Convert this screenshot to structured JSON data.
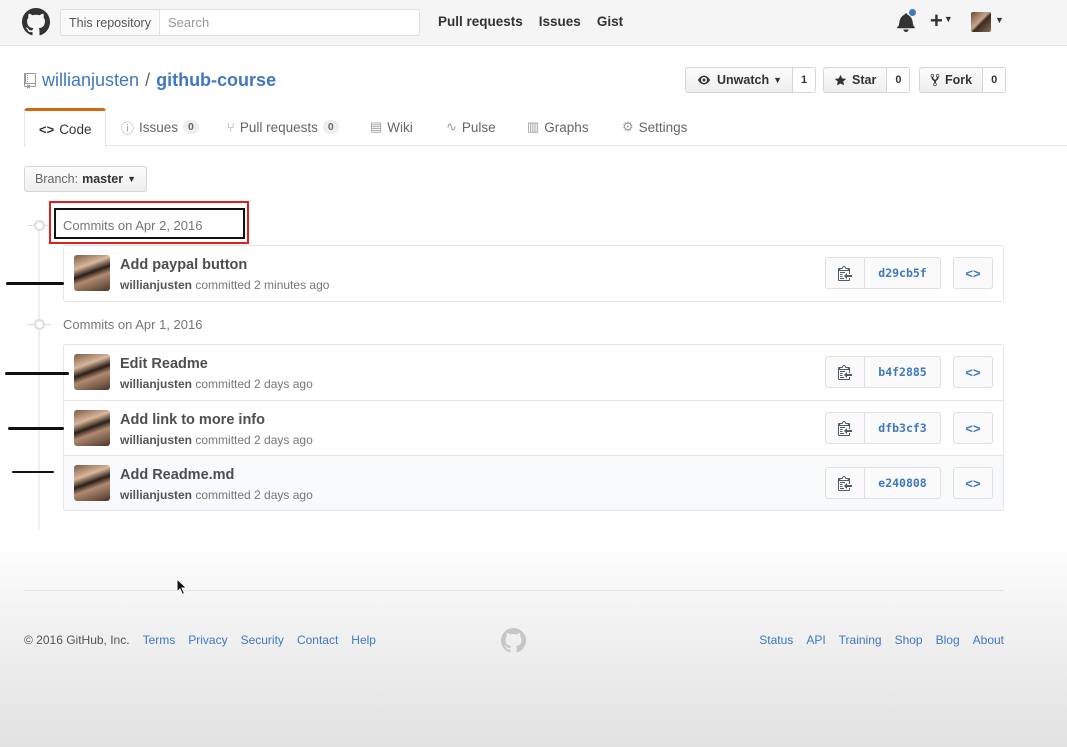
{
  "header": {
    "search_scope": "This repository",
    "search_placeholder": "Search",
    "nav": [
      "Pull requests",
      "Issues",
      "Gist"
    ],
    "plus_label": "+"
  },
  "repo": {
    "owner": "willianjusten",
    "separator": "/",
    "name": "github-course",
    "unwatch_label": "Unwatch",
    "unwatch_count": "1",
    "star_label": "Star",
    "star_count": "0",
    "fork_label": "Fork",
    "fork_count": "0"
  },
  "tabs": {
    "code": "Code",
    "issues": "Issues",
    "issues_count": "0",
    "pulls": "Pull requests",
    "pulls_count": "0",
    "wiki": "Wiki",
    "pulse": "Pulse",
    "graphs": "Graphs",
    "settings": "Settings"
  },
  "branch": {
    "label": "Branch:",
    "name": "master"
  },
  "groups": [
    {
      "title": "Commits on Apr 2, 2016",
      "commits": [
        {
          "message": "Add paypal button",
          "author": "willianjusten",
          "when": "committed 2 minutes ago",
          "sha": "d29cb5f"
        }
      ]
    },
    {
      "title": "Commits on Apr 1, 2016",
      "commits": [
        {
          "message": "Edit Readme",
          "author": "willianjusten",
          "when": "committed 2 days ago",
          "sha": "b4f2885"
        },
        {
          "message": "Add link to more info",
          "author": "willianjusten",
          "when": "committed 2 days ago",
          "sha": "dfb3cf3"
        },
        {
          "message": "Add Readme.md",
          "author": "willianjusten",
          "when": "committed 2 days ago",
          "sha": "e240808"
        }
      ]
    }
  ],
  "footer": {
    "copyright": "© 2016 GitHub, Inc.",
    "left_links": [
      "Terms",
      "Privacy",
      "Security",
      "Contact",
      "Help"
    ],
    "right_links": [
      "Status",
      "API",
      "Training",
      "Shop",
      "Blog",
      "About"
    ]
  },
  "icons": {
    "logo": "octocat-icon",
    "bell": "bell-icon",
    "eye": "eye-icon",
    "star": "star-icon",
    "fork": "fork-icon",
    "copy": "clipboard-icon",
    "browse": "code-brackets-icon"
  },
  "colors": {
    "link": "#4078c0",
    "tab_accent": "#d26911",
    "highlight_red": "#e0201a"
  }
}
